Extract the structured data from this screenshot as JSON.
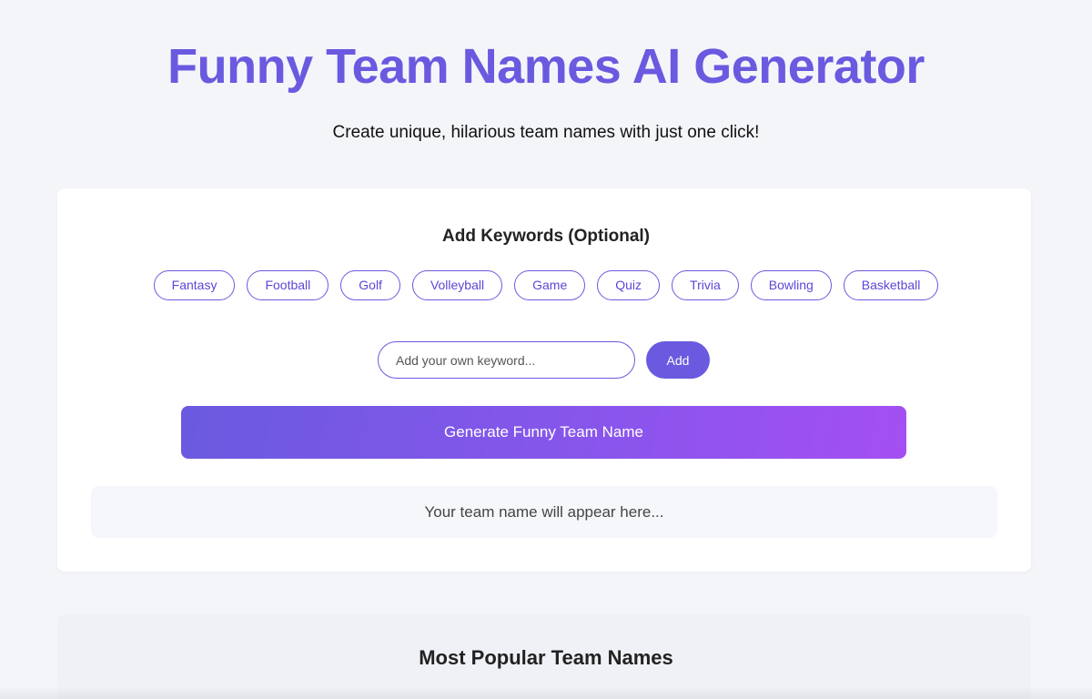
{
  "header": {
    "title": "Funny Team Names AI Generator",
    "subtitle": "Create unique, hilarious team names with just one click!"
  },
  "keywords": {
    "heading": "Add Keywords (Optional)",
    "chips": [
      "Fantasy",
      "Football",
      "Golf",
      "Volleyball",
      "Game",
      "Quiz",
      "Trivia",
      "Bowling",
      "Basketball"
    ],
    "input_placeholder": "Add your own keyword...",
    "input_value": "",
    "add_label": "Add"
  },
  "generate": {
    "button_label": "Generate Funny Team Name",
    "result_placeholder": "Your team name will appear here..."
  },
  "popular": {
    "heading": "Most Popular Team Names"
  },
  "colors": {
    "accent": "#6a5ae0",
    "gradient_end": "#a44ff2",
    "background": "#f4f5f9",
    "card": "#ffffff"
  }
}
